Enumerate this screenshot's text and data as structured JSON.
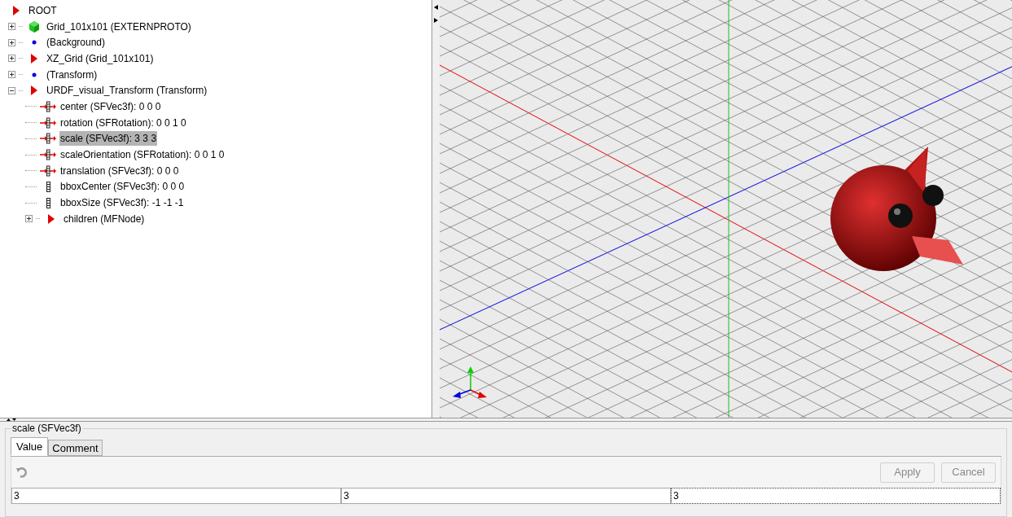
{
  "tree": {
    "label": "ROOT",
    "kind": "arrow",
    "selected": false,
    "children": [
      {
        "label": "Grid_101x101 (EXTERNPROTO)",
        "kind": "cube",
        "expanded": false,
        "selected": false
      },
      {
        "label": "(Background)",
        "kind": "dot",
        "expanded": false,
        "selected": false
      },
      {
        "label": "XZ_Grid (Grid_101x101)",
        "kind": "arrow",
        "expanded": false,
        "selected": false
      },
      {
        "label": "(Transform)",
        "kind": "dot",
        "expanded": false,
        "selected": false
      },
      {
        "label": "URDF_visual_Transform (Transform)",
        "kind": "arrow",
        "expanded": true,
        "selected": false,
        "children": [
          {
            "label": "center (SFVec3f): 0  0  0",
            "kind": "exposed",
            "selected": false
          },
          {
            "label": "rotation (SFRotation): 0  0  1  0",
            "kind": "exposed",
            "selected": false
          },
          {
            "label": "scale (SFVec3f): 3  3  3",
            "kind": "exposed",
            "selected": true
          },
          {
            "label": "scaleOrientation (SFRotation): 0  0  1  0",
            "kind": "exposed",
            "selected": false
          },
          {
            "label": "translation (SFVec3f): 0  0  0",
            "kind": "exposed",
            "selected": false
          },
          {
            "label": "bboxCenter (SFVec3f): 0  0  0",
            "kind": "field",
            "selected": false
          },
          {
            "label": "bboxSize (SFVec3f): -1 -1 -1",
            "kind": "field",
            "selected": false
          },
          {
            "label": "children (MFNode)",
            "kind": "arrow",
            "expanded": false,
            "selected": false
          }
        ]
      }
    ]
  },
  "editor": {
    "title": "scale (SFVec3f)",
    "tabs": [
      {
        "label": "Value",
        "selected": true
      },
      {
        "label": "Comment",
        "selected": false
      }
    ],
    "undo_disabled": true,
    "buttons": [
      {
        "label": "Apply",
        "disabled": true
      },
      {
        "label": "Cancel",
        "disabled": true
      }
    ],
    "values": [
      {
        "value": "3",
        "focused": false
      },
      {
        "value": "3",
        "focused": false
      },
      {
        "value": "3",
        "focused": true
      }
    ]
  }
}
